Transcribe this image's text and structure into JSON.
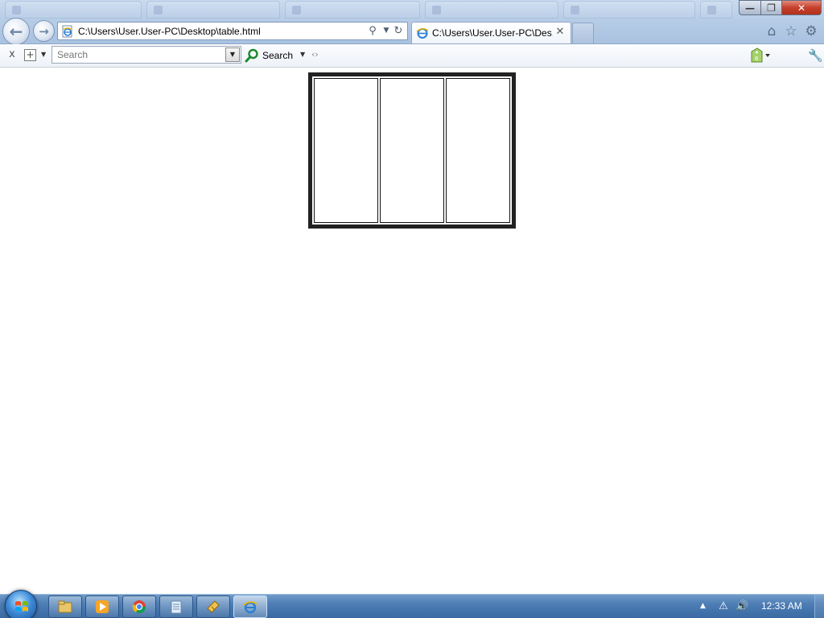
{
  "browser": {
    "address_bar": {
      "url": "C:\\Users\\User.User-PC\\Desktop\\table.html"
    },
    "active_tab": {
      "title": "C:\\Users\\User.User-PC\\Des...",
      "close_glyph": "✕"
    },
    "window_controls": {
      "minimize": "—",
      "maximize": "❐",
      "close": "✕"
    }
  },
  "toolbar": {
    "close_glyph": "x",
    "add_glyph": "+",
    "search_placeholder": "Search",
    "search_button_label": "Search"
  },
  "page": {
    "table": {
      "rows": 1,
      "columns": 3
    }
  },
  "taskbar": {
    "clock": "12:33 AM"
  },
  "colors": {
    "table_border": "#222222",
    "taskbar": "#4d7db4",
    "close_button": "#c6402c"
  }
}
